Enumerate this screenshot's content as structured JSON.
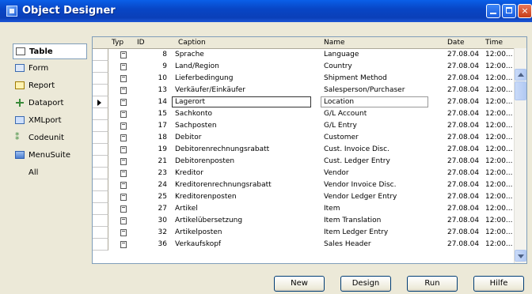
{
  "window": {
    "title": "Object Designer",
    "min_label": "",
    "max_label": "",
    "close_label": "×"
  },
  "sidebar": {
    "items": [
      {
        "label": "Table",
        "icon": "table-icon",
        "active": true
      },
      {
        "label": "Form",
        "icon": "form-icon"
      },
      {
        "label": "Report",
        "icon": "report-icon"
      },
      {
        "label": "Dataport",
        "icon": "dataport-icon"
      },
      {
        "label": "XMLport",
        "icon": "xmlport-icon"
      },
      {
        "label": "Codeunit",
        "icon": "codeunit-icon"
      },
      {
        "label": "MenuSuite",
        "icon": "menusuite-icon"
      },
      {
        "label": "All",
        "icon": ""
      }
    ]
  },
  "grid": {
    "headers": {
      "typ": "Typ",
      "id": "ID",
      "caption": "Caption",
      "name": "Name",
      "date": "Date",
      "time": "Time"
    },
    "selected_row": 4,
    "rows": [
      {
        "id": "8",
        "caption": "Sprache",
        "name": "Language",
        "date": "27.08.04",
        "time": "12:00..."
      },
      {
        "id": "9",
        "caption": "Land/Region",
        "name": "Country",
        "date": "27.08.04",
        "time": "12:00..."
      },
      {
        "id": "10",
        "caption": "Lieferbedingung",
        "name": "Shipment Method",
        "date": "27.08.04",
        "time": "12:00..."
      },
      {
        "id": "13",
        "caption": "Verkäufer/Einkäufer",
        "name": "Salesperson/Purchaser",
        "date": "27.08.04",
        "time": "12:00..."
      },
      {
        "id": "14",
        "caption": "Lagerort",
        "name": "Location",
        "date": "27.08.04",
        "time": "12:00..."
      },
      {
        "id": "15",
        "caption": "Sachkonto",
        "name": "G/L Account",
        "date": "27.08.04",
        "time": "12:00..."
      },
      {
        "id": "17",
        "caption": "Sachposten",
        "name": "G/L Entry",
        "date": "27.08.04",
        "time": "12:00..."
      },
      {
        "id": "18",
        "caption": "Debitor",
        "name": "Customer",
        "date": "27.08.04",
        "time": "12:00..."
      },
      {
        "id": "19",
        "caption": "Debitorenrechnungsrabatt",
        "name": "Cust. Invoice Disc.",
        "date": "27.08.04",
        "time": "12:00..."
      },
      {
        "id": "21",
        "caption": "Debitorenposten",
        "name": "Cust. Ledger Entry",
        "date": "27.08.04",
        "time": "12:00..."
      },
      {
        "id": "23",
        "caption": "Kreditor",
        "name": "Vendor",
        "date": "27.08.04",
        "time": "12:00..."
      },
      {
        "id": "24",
        "caption": "Kreditorenrechnungsrabatt",
        "name": "Vendor Invoice Disc.",
        "date": "27.08.04",
        "time": "12:00..."
      },
      {
        "id": "25",
        "caption": "Kreditorenposten",
        "name": "Vendor Ledger Entry",
        "date": "27.08.04",
        "time": "12:00..."
      },
      {
        "id": "27",
        "caption": "Artikel",
        "name": "Item",
        "date": "27.08.04",
        "time": "12:00..."
      },
      {
        "id": "30",
        "caption": "Artikelübersetzung",
        "name": "Item Translation",
        "date": "27.08.04",
        "time": "12:00..."
      },
      {
        "id": "32",
        "caption": "Artikelposten",
        "name": "Item Ledger Entry",
        "date": "27.08.04",
        "time": "12:00..."
      },
      {
        "id": "36",
        "caption": "Verkaufskopf",
        "name": "Sales Header",
        "date": "27.08.04",
        "time": "12:00..."
      }
    ]
  },
  "buttons": {
    "new": "New",
    "design": "Design",
    "run": "Run",
    "help": "Hilfe"
  }
}
